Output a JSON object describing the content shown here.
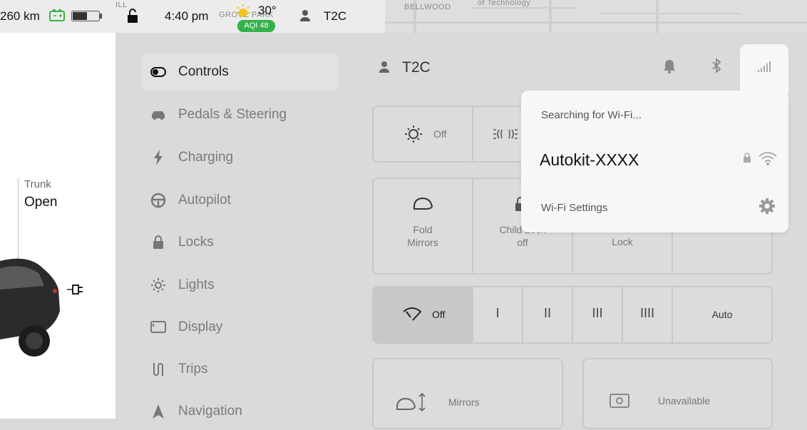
{
  "status": {
    "range": "260 km",
    "time": "4:40 pm",
    "temperature": "30°",
    "aqi": "AQI 48",
    "profile": "T2C",
    "map_labels": [
      "ILL",
      "GROVE PARK",
      "BELLWOOD",
      "of Technology"
    ]
  },
  "left_panel": {
    "trunk_label": "Trunk",
    "trunk_value": "Open"
  },
  "header": {
    "profile": "T2C"
  },
  "nav": {
    "items": [
      {
        "label": "Controls",
        "icon": "toggle-icon"
      },
      {
        "label": "Pedals & Steering",
        "icon": "car-icon"
      },
      {
        "label": "Charging",
        "icon": "bolt-icon"
      },
      {
        "label": "Autopilot",
        "icon": "steering-wheel-icon"
      },
      {
        "label": "Locks",
        "icon": "lock-icon"
      },
      {
        "label": "Lights",
        "icon": "sun-icon"
      },
      {
        "label": "Display",
        "icon": "display-icon"
      },
      {
        "label": "Trips",
        "icon": "trips-icon"
      },
      {
        "label": "Navigation",
        "icon": "navigation-arrow-icon"
      }
    ]
  },
  "controls": {
    "headlights_off": "Off",
    "fold_mirrors": "Fold\nMirrors",
    "child_lock": "Child Lock\noff",
    "lock": "Lock",
    "wiper": {
      "off": "Off",
      "speeds": [
        "I",
        "II",
        "III",
        "IIII"
      ],
      "auto": "Auto"
    },
    "mirrors": "Mirrors",
    "unavailable": "Unavailable"
  },
  "wifi_popup": {
    "searching": "Searching for Wi-Fi...",
    "network": "Autokit-XXXX",
    "settings": "Wi-Fi Settings"
  },
  "colors": {
    "aqi_green": "#33b24a",
    "battery_green": "#3cb54a"
  }
}
